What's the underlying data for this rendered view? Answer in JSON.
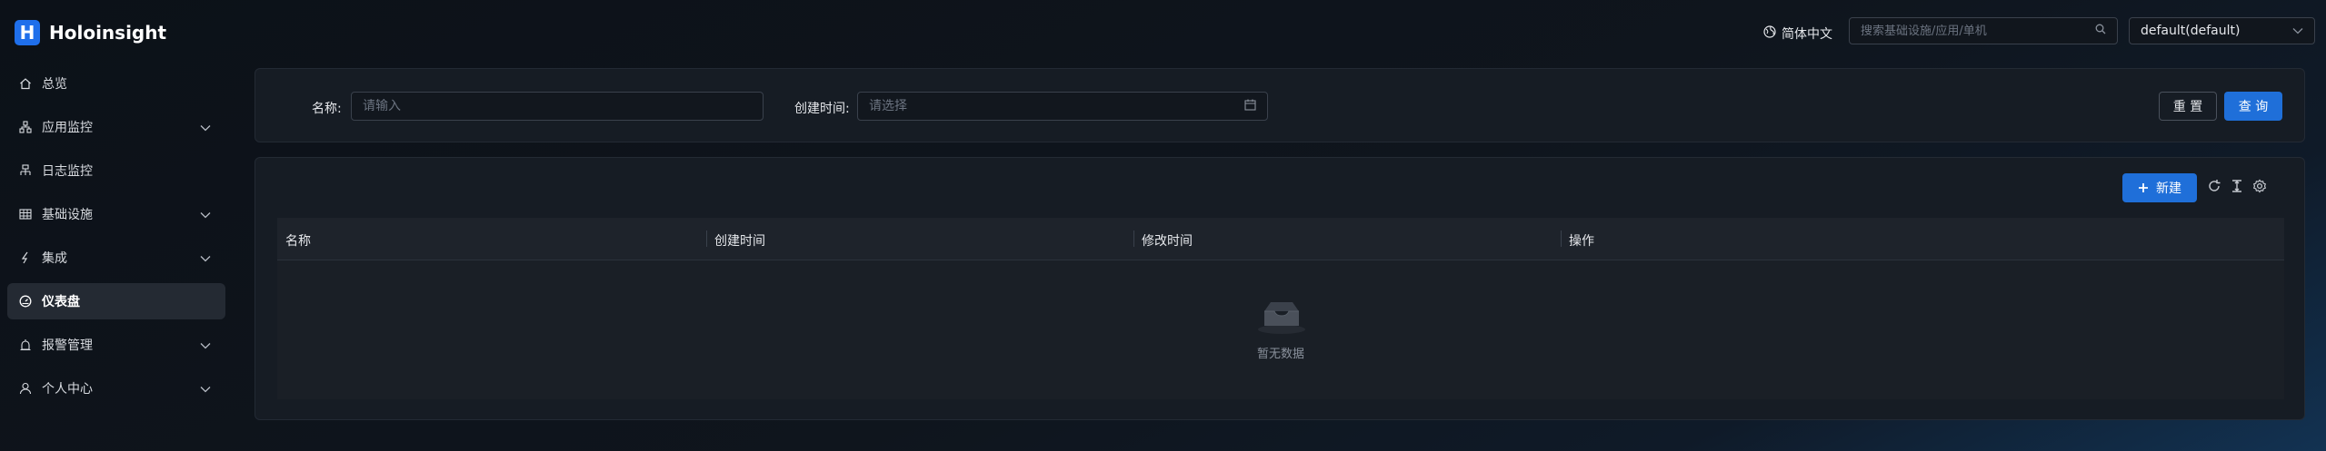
{
  "header": {
    "logo_letter": "H",
    "app_name": "Holoinsight",
    "language": "简体中文",
    "search_placeholder": "搜索基础设施/应用/单机",
    "tenant": "default(default)"
  },
  "sidebar": {
    "items": [
      {
        "label": "总览",
        "icon": "home-icon",
        "has_children": false,
        "active": false
      },
      {
        "label": "应用监控",
        "icon": "app-cluster-icon",
        "has_children": true,
        "active": false
      },
      {
        "label": "日志监控",
        "icon": "log-network-icon",
        "has_children": false,
        "active": false
      },
      {
        "label": "基础设施",
        "icon": "grid-table-icon",
        "has_children": true,
        "active": false
      },
      {
        "label": "集成",
        "icon": "plug-icon",
        "has_children": true,
        "active": false
      },
      {
        "label": "仪表盘",
        "icon": "dashboard-gauge-icon",
        "has_children": false,
        "active": true
      },
      {
        "label": "报警管理",
        "icon": "alarm-icon",
        "has_children": true,
        "active": false
      },
      {
        "label": "个人中心",
        "icon": "user-icon",
        "has_children": true,
        "active": false
      }
    ]
  },
  "filter": {
    "name_label": "名称:",
    "name_placeholder": "请输入",
    "time_label": "创建时间:",
    "time_placeholder": "请选择",
    "reset_label": "重 置",
    "query_label": "查 询"
  },
  "table": {
    "new_label": "新建",
    "columns": [
      "名称",
      "创建时间",
      "修改时间",
      "操作"
    ],
    "rows": [],
    "empty_text": "暂无数据"
  },
  "colors": {
    "primary": "#1f6fd9",
    "background": "#0f141c",
    "panel": "#161c24"
  }
}
